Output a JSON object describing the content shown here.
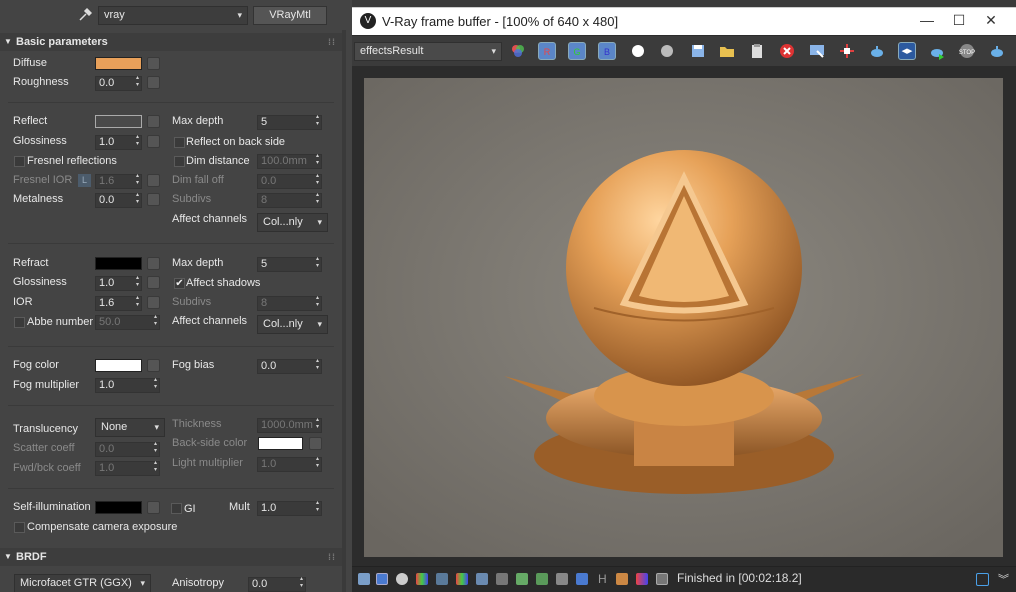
{
  "material_editor": {
    "renderer_value": "vray",
    "material_type_label": "VRayMtl",
    "basic_rollout_title": "Basic parameters",
    "brdf_rollout_title": "BRDF",
    "diffuse": {
      "label": "Diffuse",
      "color": "#e8a05a"
    },
    "roughness": {
      "label": "Roughness",
      "value": "0.0"
    },
    "reflect": {
      "label": "Reflect",
      "color": "#4a4a4a"
    },
    "glossiness": {
      "label": "Glossiness",
      "value": "1.0"
    },
    "fresnel": {
      "label": "Fresnel reflections",
      "checked": false
    },
    "fresnel_ior": {
      "label": "Fresnel IOR",
      "lock": "L",
      "value": "1.6"
    },
    "metalness": {
      "label": "Metalness",
      "value": "0.0"
    },
    "max_depth": {
      "label": "Max depth",
      "value": "5"
    },
    "reflect_back": {
      "label": "Reflect on back side"
    },
    "dim_distance": {
      "label": "Dim distance",
      "value": "100.0mm"
    },
    "dim_falloff": {
      "label": "Dim fall off",
      "value": "0.0"
    },
    "subdivs": {
      "label": "Subdivs",
      "value": "8"
    },
    "affect_channels": {
      "label": "Affect channels",
      "value": "Col...nly"
    },
    "refract": {
      "label": "Refract",
      "color": "#000000"
    },
    "refr_glossiness": {
      "label": "Glossiness",
      "value": "1.0"
    },
    "ior": {
      "label": "IOR",
      "value": "1.6"
    },
    "abbe": {
      "label": "Abbe number",
      "value": "50.0"
    },
    "refr_max_depth": {
      "label": "Max depth",
      "value": "5"
    },
    "affect_shadows": {
      "label": "Affect shadows",
      "check": "✔"
    },
    "refr_subdivs": {
      "label": "Subdivs",
      "value": "8"
    },
    "refr_affect_channels": {
      "label": "Affect channels",
      "value": "Col...nly"
    },
    "fog_color": {
      "label": "Fog color",
      "color": "#ffffff"
    },
    "fog_multiplier": {
      "label": "Fog multiplier",
      "value": "1.0"
    },
    "fog_bias": {
      "label": "Fog bias",
      "value": "0.0"
    },
    "translucency": {
      "label": "Translucency",
      "value": "None"
    },
    "scatter_coeff": {
      "label": "Scatter coeff",
      "value": "0.0"
    },
    "fwd_bck_coeff": {
      "label": "Fwd/bck coeff",
      "value": "1.0"
    },
    "thickness": {
      "label": "Thickness",
      "value": "1000.0mm"
    },
    "back_side_color": {
      "label": "Back-side color",
      "color": "#ffffff"
    },
    "light_multiplier": {
      "label": "Light multiplier",
      "value": "1.0"
    },
    "self_illum": {
      "label": "Self-illumination",
      "color": "#000000"
    },
    "gi": {
      "label": "GI"
    },
    "mult": {
      "label": "Mult",
      "value": "1.0"
    },
    "compensate": {
      "label": "Compensate camera exposure"
    },
    "brdf_type": {
      "value": "Microfacet GTR (GGX)"
    },
    "anisotropy": {
      "label": "Anisotropy",
      "value": "0.0"
    }
  },
  "vfb": {
    "title": "V-Ray frame buffer - [100% of 640 x 480]",
    "channel": "effectsResult",
    "r_label": "R",
    "g_label": "G",
    "b_label": "B",
    "status_text": "Finished in [00:02:18.2]",
    "status_h": "H"
  }
}
